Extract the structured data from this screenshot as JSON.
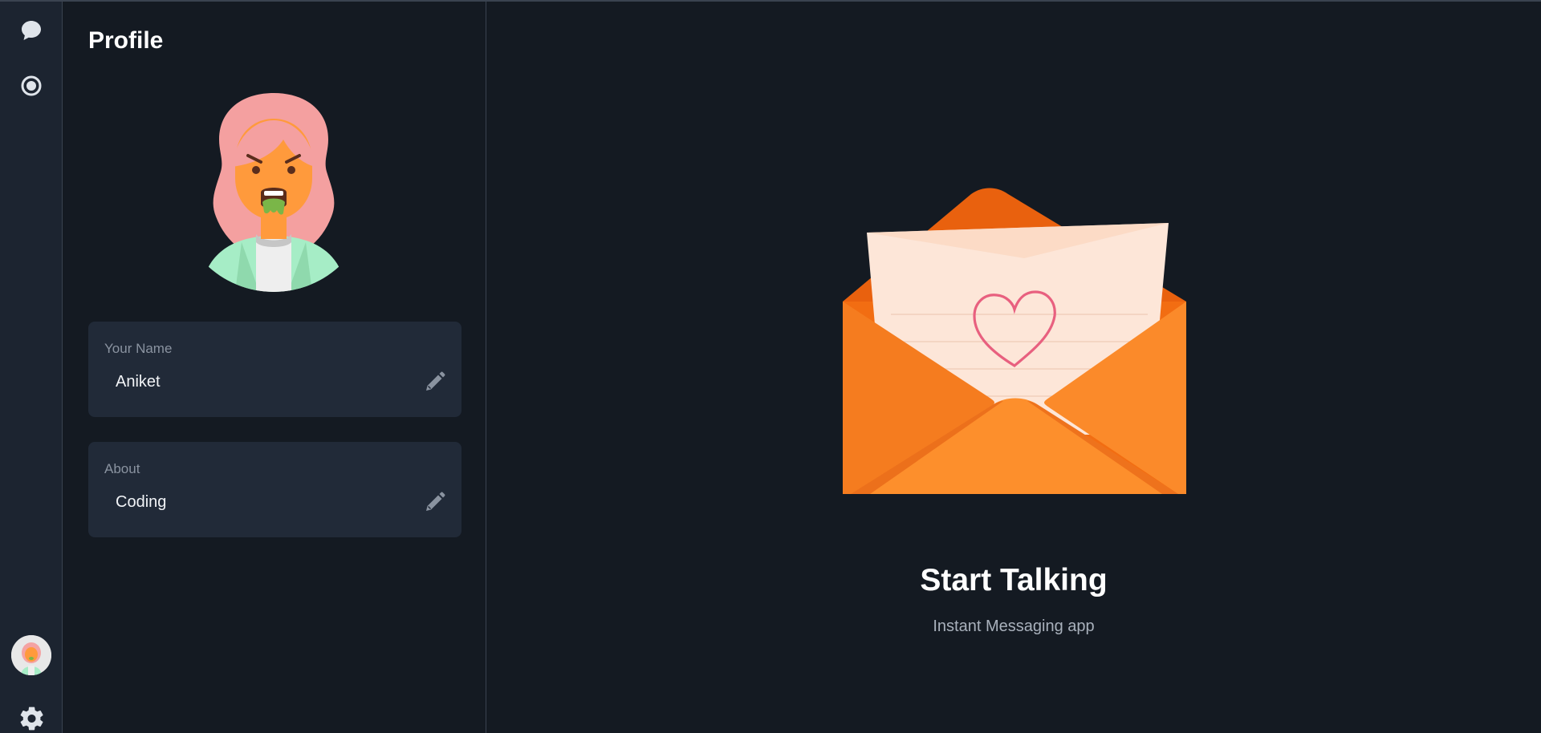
{
  "rail": {
    "icons": [
      "chat-bubble-icon",
      "status-icon",
      "settings-icon"
    ]
  },
  "profile": {
    "title": "Profile",
    "name_card": {
      "label": "Your Name",
      "value": "Aniket"
    },
    "about_card": {
      "label": "About",
      "value": "Coding"
    }
  },
  "main": {
    "title": "Start Talking",
    "subtitle": "Instant Messaging app"
  },
  "colors": {
    "background": "#141a22",
    "rail": "#1c2430",
    "card": "#212a38",
    "envelope": "#f77f1f"
  }
}
